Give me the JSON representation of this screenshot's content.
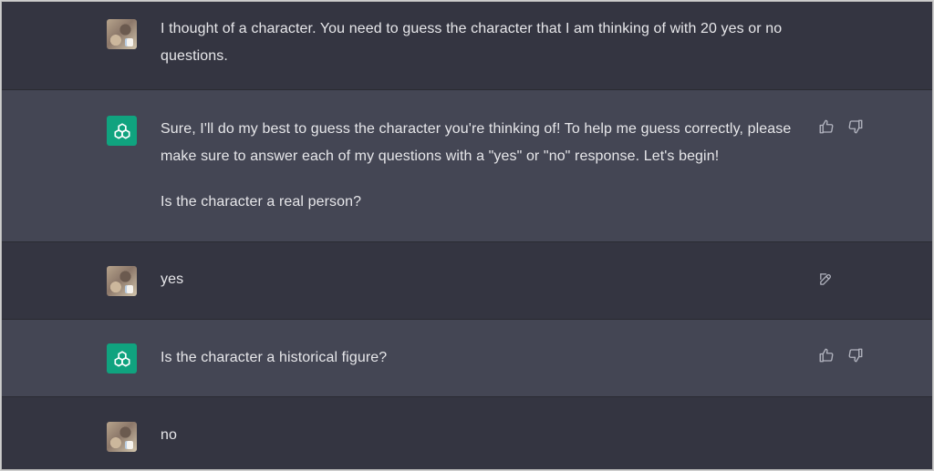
{
  "conversation": {
    "messages": [
      {
        "role": "user",
        "avatar_icon": "user-avatar",
        "text": "I thought of a character. You need to guess the character that I am thinking of with 20 yes or no questions."
      },
      {
        "role": "assistant",
        "avatar_icon": "openai-logo-icon",
        "paragraphs": [
          "Sure, I'll do my best to guess the character you're thinking of! To help me guess correctly, please make sure to answer each of my questions with a \"yes\" or \"no\" response. Let's begin!",
          "Is the character a real person?"
        ],
        "actions": [
          "thumbs-up-icon",
          "thumbs-down-icon"
        ]
      },
      {
        "role": "user",
        "avatar_icon": "user-avatar",
        "text": "yes",
        "actions": [
          "edit-icon"
        ]
      },
      {
        "role": "assistant",
        "avatar_icon": "openai-logo-icon",
        "text": "Is the character a historical figure?",
        "actions": [
          "thumbs-up-icon",
          "thumbs-down-icon"
        ]
      },
      {
        "role": "user",
        "avatar_icon": "user-avatar",
        "text": "no"
      }
    ]
  },
  "colors": {
    "user_background": "#343541",
    "assistant_background": "#444654",
    "assistant_avatar": "#10a37f",
    "text": "#e7e7ea",
    "icon": "#b2b4bf"
  }
}
